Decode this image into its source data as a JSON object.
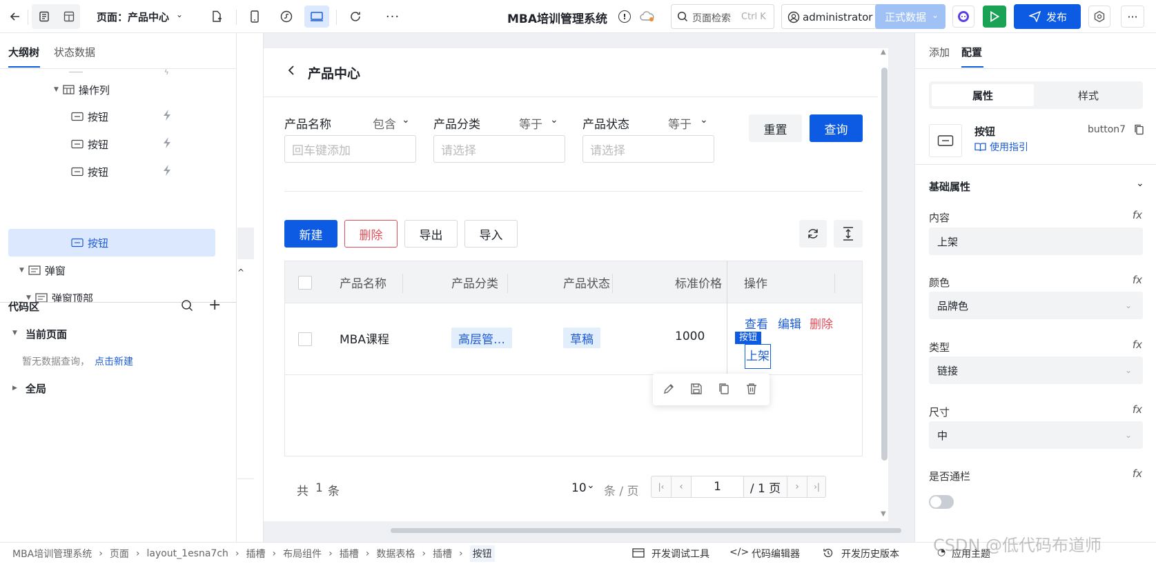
{
  "topbar": {
    "page_label": "页面：产品中心",
    "app_title": "MBA培训管理系统",
    "search_placeholder": "页面检索",
    "search_shortcut": "Ctrl K",
    "user": "administrator",
    "env": "正式数据",
    "publish": "发布"
  },
  "left": {
    "tab_outline": "大纲树",
    "tab_state": "状态数据",
    "tree": [
      "操作列",
      "按钮",
      "按钮",
      "按钮",
      "按钮",
      "弹窗",
      "弹窗顶部"
    ],
    "code_title": "代码区",
    "current_page": "当前页面",
    "no_query": "暂无数据查询，",
    "create_new": "点击新建",
    "global": "全局"
  },
  "page": {
    "title": "产品中心",
    "filters": [
      {
        "label": "产品名称",
        "op": "包含",
        "placeholder": "回车键添加"
      },
      {
        "label": "产品分类",
        "op": "等于",
        "placeholder": "请选择"
      },
      {
        "label": "产品状态",
        "op": "等于",
        "placeholder": "请选择"
      }
    ],
    "reset": "重置",
    "query": "查询",
    "actions": [
      "新建",
      "删除",
      "导出",
      "导入"
    ],
    "columns": [
      "产品名称",
      "产品分类",
      "产品状态",
      "标准价格",
      "操作"
    ],
    "row": {
      "name": "MBA课程",
      "category": "高层管…",
      "status": "草稿",
      "price": "1000",
      "op_view": "查看",
      "op_edit": "编辑",
      "op_delete": "删除",
      "op_shelf": "上架",
      "selected_badge": "按钮"
    },
    "pagination": {
      "total_prefix": "共",
      "total": "1",
      "total_suffix": "条",
      "page_size": "10",
      "per_page": "条 / 页",
      "current": "1",
      "pages": "/ 1 页"
    }
  },
  "right": {
    "tab_add": "添加",
    "tab_config": "配置",
    "seg_props": "属性",
    "seg_style": "样式",
    "comp_name": "按钮",
    "comp_id": "button7",
    "guide": "使用指引",
    "section": "基础属性",
    "props": [
      {
        "label": "内容",
        "value": "上架"
      },
      {
        "label": "颜色",
        "value": "品牌色"
      },
      {
        "label": "类型",
        "value": "链接"
      },
      {
        "label": "尺寸",
        "value": "中"
      }
    ],
    "block_label": "是否通栏"
  },
  "bottom": {
    "crumbs": [
      "MBA培训管理系统",
      "页面",
      "layout_1esna7ch",
      "插槽",
      "布局组件",
      "插槽",
      "数据表格",
      "插槽",
      "按钮"
    ],
    "dev_tools": "开发调试工具",
    "code_editor": "代码编辑器",
    "history": "开发历史版本",
    "theme": "应用主题",
    "watermark": "CSDN @低代码布道师"
  }
}
